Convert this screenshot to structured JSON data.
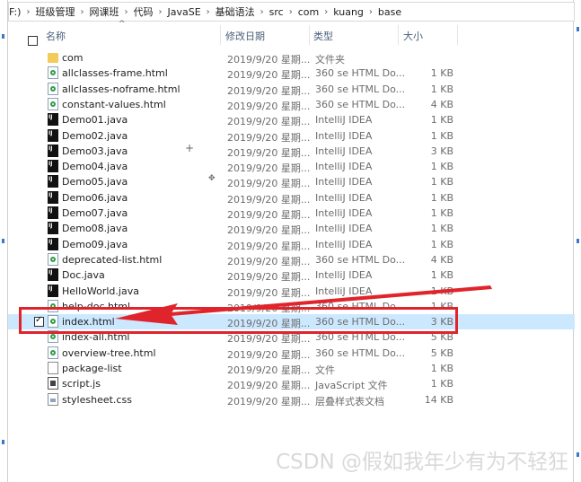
{
  "breadcrumb": [
    "F:)",
    "班级管理",
    "网课班",
    "代码",
    "JavaSE",
    "基础语法",
    "src",
    "com",
    "kuang",
    "base"
  ],
  "columns": {
    "name": "名称",
    "modified": "修改日期",
    "type": "类型",
    "size": "大小"
  },
  "files": [
    {
      "name": "com",
      "date": "2019/9/20 星期...",
      "type": "文件夹",
      "size": "",
      "icon": "folder-icon"
    },
    {
      "name": "allclasses-frame.html",
      "date": "2019/9/20 星期...",
      "type": "360 se HTML Do...",
      "size": "1 KB",
      "icon": "html-file-icon"
    },
    {
      "name": "allclasses-noframe.html",
      "date": "2019/9/20 星期...",
      "type": "360 se HTML Do...",
      "size": "1 KB",
      "icon": "html-file-icon"
    },
    {
      "name": "constant-values.html",
      "date": "2019/9/20 星期...",
      "type": "360 se HTML Do...",
      "size": "4 KB",
      "icon": "html-file-icon"
    },
    {
      "name": "Demo01.java",
      "date": "2019/9/20 星期...",
      "type": "IntelliJ IDEA",
      "size": "1 KB",
      "icon": "java-file-icon"
    },
    {
      "name": "Demo02.java",
      "date": "2019/9/20 星期...",
      "type": "IntelliJ IDEA",
      "size": "1 KB",
      "icon": "java-file-icon"
    },
    {
      "name": "Demo03.java",
      "date": "2019/9/20 星期...",
      "type": "IntelliJ IDEA",
      "size": "3 KB",
      "icon": "java-file-icon"
    },
    {
      "name": "Demo04.java",
      "date": "2019/9/20 星期...",
      "type": "IntelliJ IDEA",
      "size": "1 KB",
      "icon": "java-file-icon"
    },
    {
      "name": "Demo05.java",
      "date": "2019/9/20 星期...",
      "type": "IntelliJ IDEA",
      "size": "1 KB",
      "icon": "java-file-icon"
    },
    {
      "name": "Demo06.java",
      "date": "2019/9/20 星期...",
      "type": "IntelliJ IDEA",
      "size": "1 KB",
      "icon": "java-file-icon"
    },
    {
      "name": "Demo07.java",
      "date": "2019/9/20 星期...",
      "type": "IntelliJ IDEA",
      "size": "1 KB",
      "icon": "java-file-icon"
    },
    {
      "name": "Demo08.java",
      "date": "2019/9/20 星期...",
      "type": "IntelliJ IDEA",
      "size": "1 KB",
      "icon": "java-file-icon"
    },
    {
      "name": "Demo09.java",
      "date": "2019/9/20 星期...",
      "type": "IntelliJ IDEA",
      "size": "1 KB",
      "icon": "java-file-icon"
    },
    {
      "name": "deprecated-list.html",
      "date": "2019/9/20 星期...",
      "type": "360 se HTML Do...",
      "size": "4 KB",
      "icon": "html-file-icon"
    },
    {
      "name": "Doc.java",
      "date": "2019/9/20 星期...",
      "type": "IntelliJ IDEA",
      "size": "1 KB",
      "icon": "java-file-icon"
    },
    {
      "name": "HelloWorld.java",
      "date": "2019/9/20 星期...",
      "type": "IntelliJ IDEA",
      "size": "1 KB",
      "icon": "java-file-icon"
    },
    {
      "name": "help-doc.html",
      "date": "2019/9/20 星期...",
      "type": "360 se HTML Do...",
      "size": "1 KB",
      "icon": "html-file-icon"
    },
    {
      "name": "index.html",
      "date": "2019/9/20 星期...",
      "type": "360 se HTML Do...",
      "size": "3 KB",
      "icon": "html-file-icon",
      "selected": true
    },
    {
      "name": "index-all.html",
      "date": "2019/9/20 星期...",
      "type": "360 se HTML Do...",
      "size": "5 KB",
      "icon": "html-file-icon"
    },
    {
      "name": "overview-tree.html",
      "date": "2019/9/20 星期...",
      "type": "360 se HTML Do...",
      "size": "5 KB",
      "icon": "html-file-icon"
    },
    {
      "name": "package-list",
      "date": "2019/9/20 星期...",
      "type": "文件",
      "size": "1 KB",
      "icon": "file-icon"
    },
    {
      "name": "script.js",
      "date": "2019/9/20 星期...",
      "type": "JavaScript 文件",
      "size": "1 KB",
      "icon": "js-file-icon"
    },
    {
      "name": "stylesheet.css",
      "date": "2019/9/20 星期...",
      "type": "层叠样式表文档",
      "size": "14 KB",
      "icon": "css-file-icon"
    }
  ],
  "watermark": "CSDN @假如我年少有为不轻狂",
  "colors": {
    "selection": "#cce8ff",
    "highlight": "#e0242b",
    "header_text": "#4c607a"
  }
}
